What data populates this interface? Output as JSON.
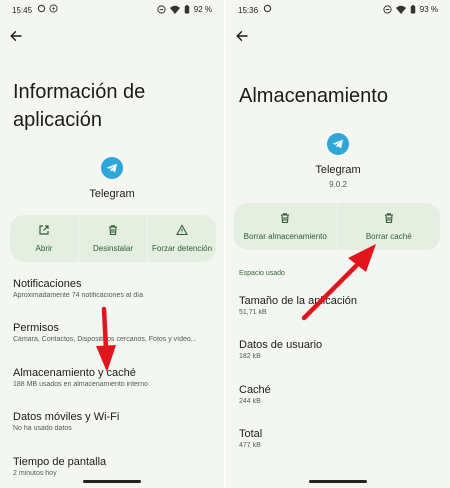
{
  "left": {
    "status": {
      "time": "15:45",
      "battery": "92 %"
    },
    "title_line1": "Información de",
    "title_line2": "aplicación",
    "app_name": "Telegram",
    "actions": [
      {
        "label": "Abrir",
        "icon": "open-external-icon"
      },
      {
        "label": "Desinstalar",
        "icon": "trash-icon"
      },
      {
        "label": "Forzar detención",
        "icon": "warning-icon"
      }
    ],
    "rows": [
      {
        "title": "Notificaciones",
        "subtitle": "Aproximadamente 74 notificaciones al día"
      },
      {
        "title": "Permisos",
        "subtitle": "Cámara, Contactos, Dispositivos cercanos, Fotos y vídeo..."
      },
      {
        "title": "Almacenamiento y caché",
        "subtitle": "188 MB usados en almacenamiento interno"
      },
      {
        "title": "Datos móviles y Wi-Fi",
        "subtitle": "No ha usado datos"
      },
      {
        "title": "Tiempo de pantalla",
        "subtitle": "2 minutos hoy"
      }
    ]
  },
  "right": {
    "status": {
      "time": "15:36",
      "battery": "93 %"
    },
    "title": "Almacenamiento",
    "app_name": "Telegram",
    "version": "9.0.2",
    "actions": [
      {
        "label": "Borrar almacenamiento",
        "icon": "trash-icon"
      },
      {
        "label": "Borrar caché",
        "icon": "trash-icon"
      }
    ],
    "section_header": "Espacio usado",
    "rows": [
      {
        "title": "Tamaño de la aplicación",
        "subtitle": "51,71 kB"
      },
      {
        "title": "Datos de usuario",
        "subtitle": "182 kB"
      },
      {
        "title": "Caché",
        "subtitle": "244 kB"
      },
      {
        "title": "Total",
        "subtitle": "477 kB"
      }
    ]
  },
  "colors": {
    "accent": "#2f5f34",
    "arrow": "#e3141b",
    "telegram": "#2ea6da",
    "card": "#e4eee1"
  }
}
